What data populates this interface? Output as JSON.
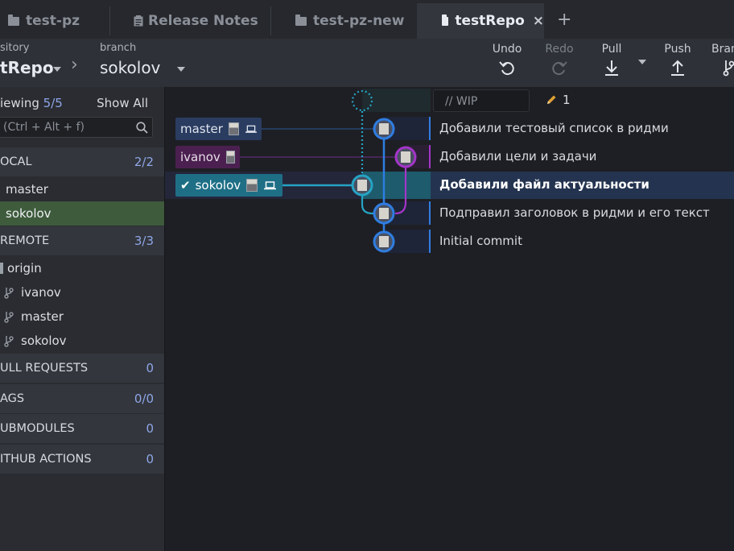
{
  "tabs": [
    {
      "label": "test-pz",
      "icon": "folder-icon",
      "active": false
    },
    {
      "label": "Release Notes",
      "icon": "notes-icon",
      "active": false
    },
    {
      "label": "test-pz-new",
      "icon": "folder-icon",
      "active": false
    },
    {
      "label": "testRepo",
      "icon": "folder-icon",
      "active": true,
      "close": "×"
    }
  ],
  "new_tab_label": "+",
  "toolbar": {
    "repo_label": "sitory",
    "repo_value": "tRepo",
    "branch_label": "branch",
    "branch_value": "sokolov",
    "actions": [
      {
        "label": "Undo",
        "icon": "undo-icon",
        "enabled": true
      },
      {
        "label": "Redo",
        "icon": "redo-icon",
        "enabled": false
      },
      {
        "label": "Pull",
        "icon": "pull-icon",
        "enabled": true
      },
      {
        "label": "Push",
        "icon": "push-icon",
        "enabled": true
      },
      {
        "label": "Bran",
        "icon": "branch-icon",
        "enabled": true
      }
    ]
  },
  "sidebar": {
    "viewing_label": "iewing",
    "viewing_count": "5",
    "viewing_total": "/5",
    "show_all": "Show All",
    "filter_placeholder": "(Ctrl + Alt + f)",
    "local": {
      "title": "OCAL",
      "count": "2/2",
      "items": [
        "master",
        "sokolov"
      ]
    },
    "remote": {
      "title": "REMOTE",
      "count": "3/3",
      "origin": "origin",
      "items": [
        "ivanov",
        "master",
        "sokolov"
      ]
    },
    "pull_requests": {
      "title": "ULL REQUESTS",
      "count": "0"
    },
    "tags": {
      "title": "AGS",
      "count": "0/0"
    },
    "submodules": {
      "title": "UBMODULES",
      "count": "0"
    },
    "github_actions": {
      "title": "ITHUB ACTIONS",
      "count": "0"
    }
  },
  "graph": {
    "wip_placeholder": "// WIP",
    "wip_count": "1",
    "commits": [
      {
        "message": "Добавили тестовый список в ридми",
        "ref": "master"
      },
      {
        "message": "Добавили цели и задачи",
        "ref": "ivanov"
      },
      {
        "message": "Добавили файл актуальности",
        "ref": "sokolov",
        "selected": true
      },
      {
        "message": "Подправил заголовок в ридми и его текст"
      },
      {
        "message": "Initial commit"
      }
    ]
  },
  "colors": {
    "master": "#2f7de1",
    "ivanov": "#a435c9",
    "sokolov": "#25a3c4",
    "accent": "#8ea6e8"
  }
}
